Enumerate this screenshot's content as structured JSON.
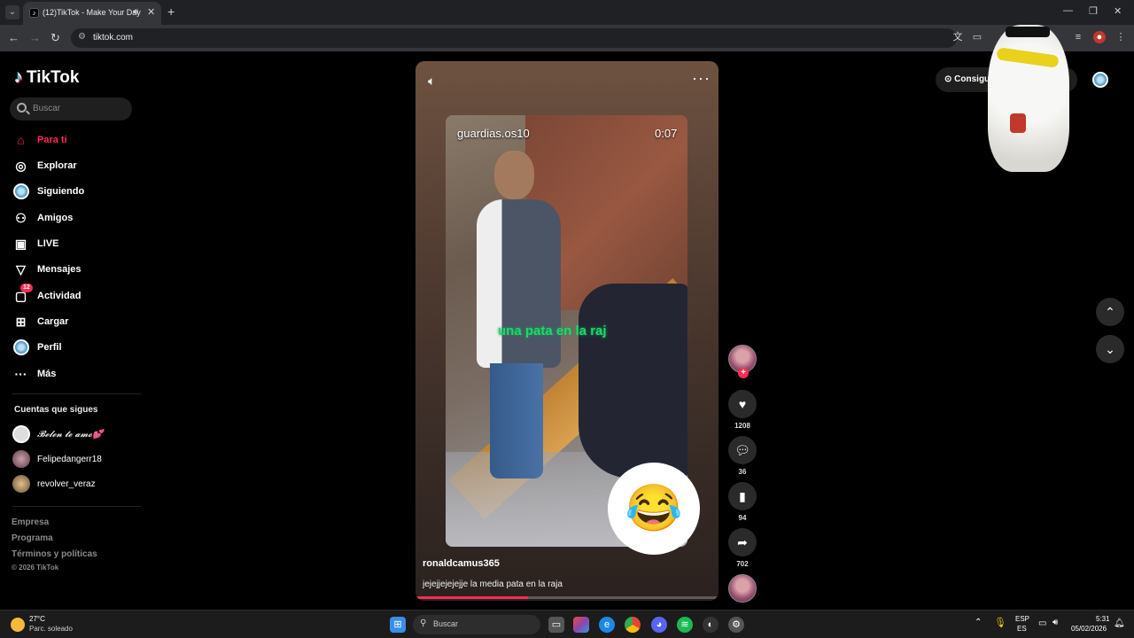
{
  "browser": {
    "tab_title": "(12)TikTok - Make Your Day",
    "tab_audio_icon": "speaker-icon",
    "url": "tiktok.com"
  },
  "sidebar": {
    "logo_text": "TikTok",
    "search_placeholder": "Buscar",
    "items": [
      {
        "label": "Para ti",
        "icon": "home-icon",
        "active": true
      },
      {
        "label": "Explorar",
        "icon": "compass-icon"
      },
      {
        "label": "Siguiendo",
        "icon": "following-icon"
      },
      {
        "label": "Amigos",
        "icon": "friends-icon"
      },
      {
        "label": "LIVE",
        "icon": "live-icon"
      },
      {
        "label": "Mensajes",
        "icon": "messages-icon"
      },
      {
        "label": "Actividad",
        "icon": "activity-icon",
        "badge": "12"
      },
      {
        "label": "Cargar",
        "icon": "upload-icon"
      },
      {
        "label": "Perfil",
        "icon": "profile-icon"
      },
      {
        "label": "Más",
        "icon": "more-icon"
      }
    ],
    "following_title": "Cuentas que sigues",
    "following": [
      {
        "name": "𝓑𝓮𝓵𝓮𝓷 𝓽𝓮 𝓪𝓶𝓸💕"
      },
      {
        "name": "Felipedangerr18"
      },
      {
        "name": "revolver_veraz"
      }
    ],
    "footer": [
      "Empresa",
      "Programa",
      "Términos y políticas"
    ],
    "copyright": "© 2026 TikTok"
  },
  "video": {
    "source_watermark": "guardias.os10",
    "timestamp": "0:07",
    "overlay_caption": "una pata en la raj",
    "emoji": "😂",
    "author": "ronaldcamus365",
    "description": "jejejjejejejje la media pata en la raja",
    "progress": 0.37
  },
  "actions": {
    "likes": "1208",
    "comments": "36",
    "saves": "94",
    "shares": "702"
  },
  "header_right": {
    "coins_label": "Consigue"
  },
  "taskbar": {
    "temperature": "27°C",
    "weather": "Parc. soleado",
    "search": "Buscar",
    "lang1": "ESP",
    "lang2": "ES",
    "time": "5:31",
    "date": "05/02/2026"
  }
}
